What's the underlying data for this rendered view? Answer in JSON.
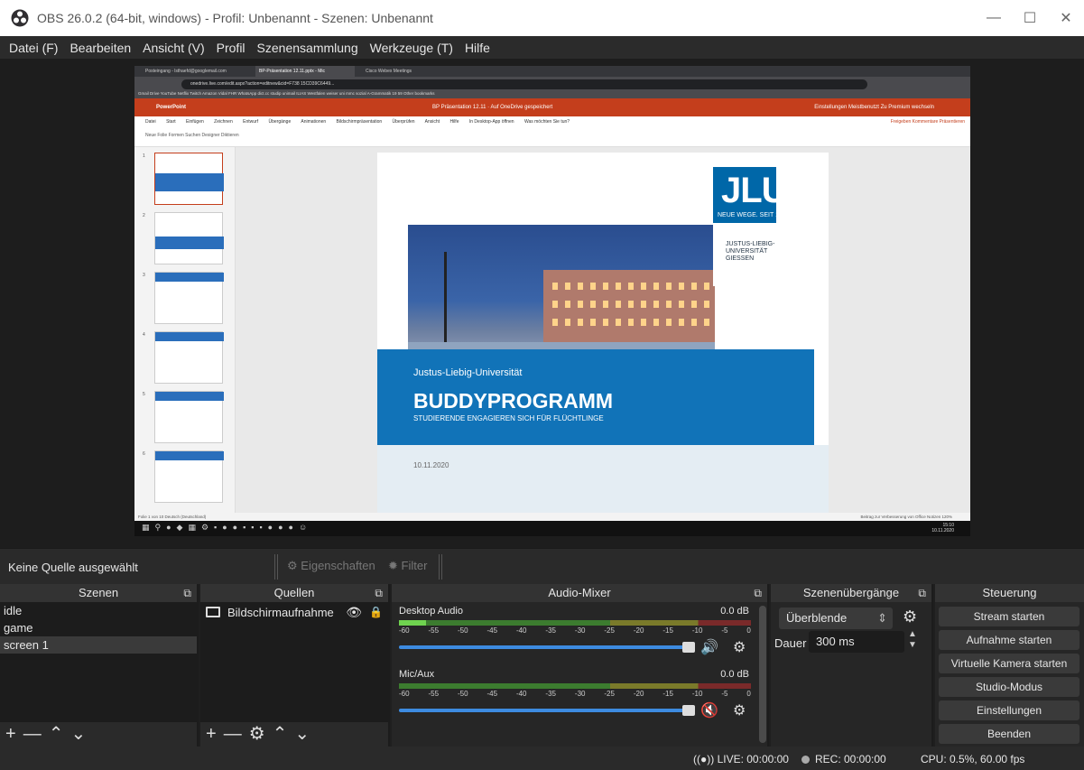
{
  "window": {
    "title": "OBS 26.0.2 (64-bit, windows) - Profil: Unbenannt - Szenen: Unbenannt"
  },
  "menu": [
    "Datei (F)",
    "Bearbeiten",
    "Ansicht (V)",
    "Profil",
    "Szenensammlung",
    "Werkzeuge (T)",
    "Hilfe"
  ],
  "preview": {
    "browser_tabs": [
      "Posteingang - lsthaefd@googlemail.com",
      "BP-Präsentation 12.11.pptx - Mic",
      "Cisco Webex Meetings"
    ],
    "url": "onedrive.live.com/edit.aspx?action=editnew&cid=F738 15CD39C6449...",
    "bookmarks": "Gmail  Drive  YouTube  Netflix  Twitch  Amazon  Vidal  FHR  WhatsApp  dict.cc  studip  unimail  ILIAS  Westfalen  weiser  uni  mmc  sozial  A-Grammatik  19  59  Other bookmarks",
    "ppt_brand": "PowerPoint",
    "ppt_doc": "BP Präsentation 12.11 · Auf OneDrive gespeichert",
    "ppt_right": "Einstellungen Meistbenutzt   Zu Premium wechseln",
    "ribbon_tabs": [
      "Datei",
      "Start",
      "Einfügen",
      "Zeichnen",
      "Entwurf",
      "Übergänge",
      "Animationen",
      "Bildschirmpräsentation",
      "Überprüfen",
      "Ansicht",
      "Hilfe",
      "In Desktop-App öffnen",
      "Was möchten Sie tun?"
    ],
    "ribbon_tools": "Neue Folie   Formen   Suchen   Designer   Diktieren",
    "ribbon_right": "Freigeben   Kommentare   Präsentieren",
    "slide": {
      "logo": "JLU",
      "logo_tag": "NEUE WEGE. SEIT 1607.",
      "uni_name": "JUSTUS-LIEBIG-UNIVERSITÄT GIESSEN",
      "uni_line": "Justus-Liebig-Universität",
      "title": "BUDDYPROGRAMM",
      "subtitle": "STUDIERENDE ENGAGIEREN SICH FÜR FLÜCHTLINGE",
      "date": "10.11.2020"
    },
    "ppt_status": "Folie 1 von 10    Deutsch (Deutschland)",
    "ppt_status_right": "Beitrag zur Verbesserung von Office   Notizen   120%",
    "clock_time": "15:10",
    "clock_date": "10.11.2020"
  },
  "sourcebar": {
    "no_source": "Keine Quelle ausgewählt",
    "properties": "Eigenschaften",
    "filter": "Filter"
  },
  "docks": {
    "scenes": {
      "title": "Szenen",
      "items": [
        "idle",
        "game",
        "screen 1"
      ],
      "selected": 2
    },
    "sources": {
      "title": "Quellen",
      "items": [
        {
          "label": "Bildschirmaufnahme"
        }
      ]
    },
    "mixer": {
      "title": "Audio-Mixer",
      "channels": [
        {
          "name": "Desktop Audio",
          "db": "0.0 dB",
          "muted": false
        },
        {
          "name": "Mic/Aux",
          "db": "0.0 dB",
          "muted": true
        }
      ],
      "ticks": [
        "-60",
        "-55",
        "-50",
        "-45",
        "-40",
        "-35",
        "-30",
        "-25",
        "-20",
        "-15",
        "-10",
        "-5",
        "0"
      ]
    },
    "transitions": {
      "title": "Szenenübergänge",
      "selected": "Überblende",
      "duration_label": "Dauer",
      "duration": "300 ms"
    },
    "controls": {
      "title": "Steuerung",
      "buttons": [
        "Stream starten",
        "Aufnahme starten",
        "Virtuelle Kamera starten",
        "Studio-Modus",
        "Einstellungen",
        "Beenden"
      ]
    }
  },
  "status": {
    "live": "LIVE: 00:00:00",
    "rec": "REC: 00:00:00",
    "cpu": "CPU: 0.5%, 60.00 fps"
  }
}
